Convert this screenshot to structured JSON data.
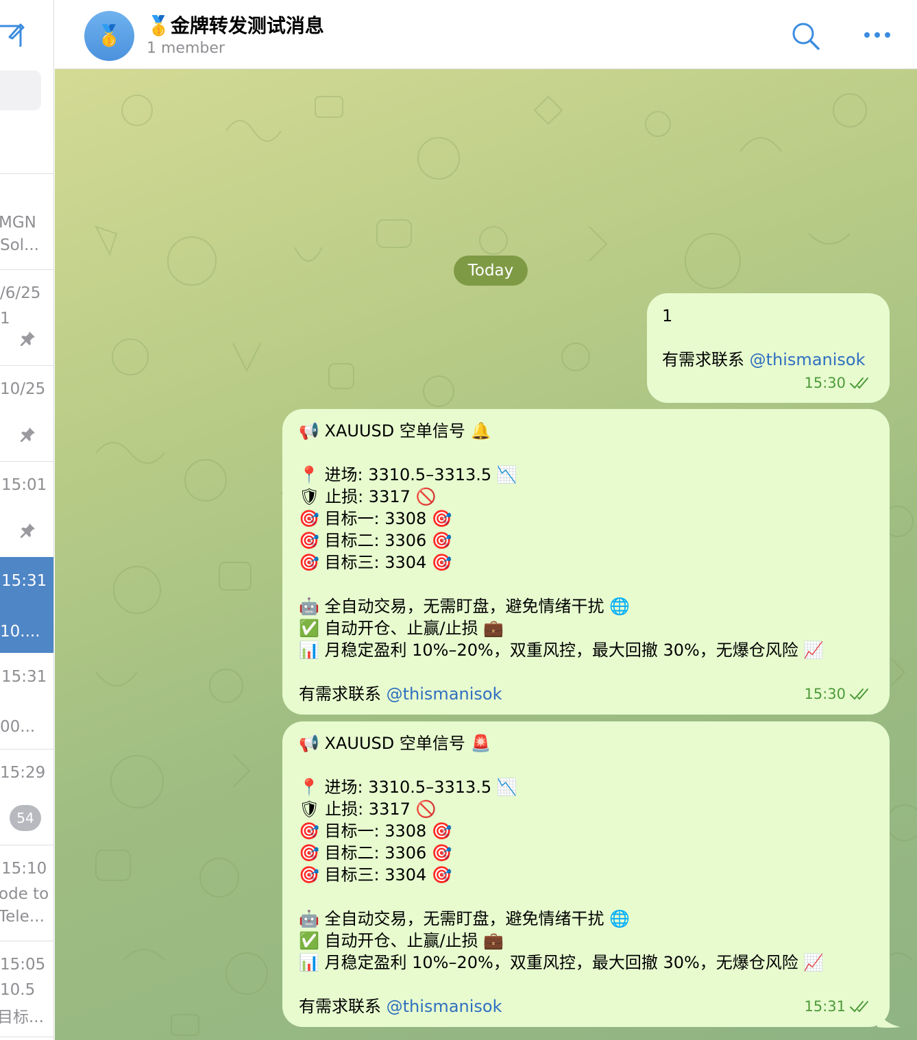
{
  "sidebar": {
    "rows": [
      {
        "l1": "MGN",
        "l2": "Sol..."
      },
      {
        "l1": "/6/25",
        "l2": "1"
      },
      {
        "l1": "10/25"
      },
      {
        "l1": "15:01"
      },
      {
        "l1": "15:31",
        "l2": "10...."
      },
      {
        "l1": "15:31",
        "l2": "00..."
      },
      {
        "l1": "15:29",
        "badge": "54"
      },
      {
        "l1": "15:10",
        "l2": "ode to",
        "l3": "Tele..."
      },
      {
        "l1": "15:05",
        "l2": "10.5",
        "l3": "目标..."
      }
    ]
  },
  "header": {
    "avatar_emoji": "🥇",
    "title": "🥇金牌转发测试消息",
    "subtitle": "1 member"
  },
  "date_divider": "Today",
  "messages": [
    {
      "lines": [
        "1",
        "",
        "有需求联系 "
      ],
      "mention": "@thismanisok",
      "time": "15:30"
    },
    {
      "l1": "📢 XAUUSD 空单信号 🔔",
      "l2": "📍 进场: 3310.5–3313.5 📉",
      "l3": "🛡 止损: 3317 🚫",
      "l4": "🎯 目标一: 3308 🎯",
      "l5": "🎯 目标二: 3306 🎯",
      "l6": "🎯 目标三: 3304 🎯",
      "l7": "🤖 全自动交易，无需盯盘，避免情绪干扰 🌐",
      "l8": "✅ 自动开仓、止赢/止损 💼",
      "l9": "📊 月稳定盈利 10%–20%，双重风控，最大回撤 30%，无爆仓风险 📈",
      "contact": "有需求联系 ",
      "mention": "@thismanisok",
      "time": "15:30"
    },
    {
      "l1": "📢 XAUUSD 空单信号 🚨",
      "l2": "📍 进场: 3310.5–3313.5 📉",
      "l3": "🛡 止损: 3317 🚫",
      "l4": "🎯 目标一: 3308 🎯",
      "l5": "🎯 目标二: 3306 🎯",
      "l6": "🎯 目标三: 3304 🎯",
      "l7": "🤖 全自动交易，无需盯盘，避免情绪干扰 🌐",
      "l8": "✅ 自动开仓、止赢/止损 💼",
      "l9": "📊 月稳定盈利 10%–20%，双重风控，最大回撤 30%，无爆仓风险 📈",
      "contact": "有需求联系 ",
      "mention": "@thismanisok",
      "time": "15:31"
    }
  ],
  "colors": {
    "accent": "#4f86c6",
    "bubble": "#e7fbcf",
    "mention": "#2f6fbf",
    "time": "#4d9a38",
    "date_pill": "#7f9a45"
  }
}
